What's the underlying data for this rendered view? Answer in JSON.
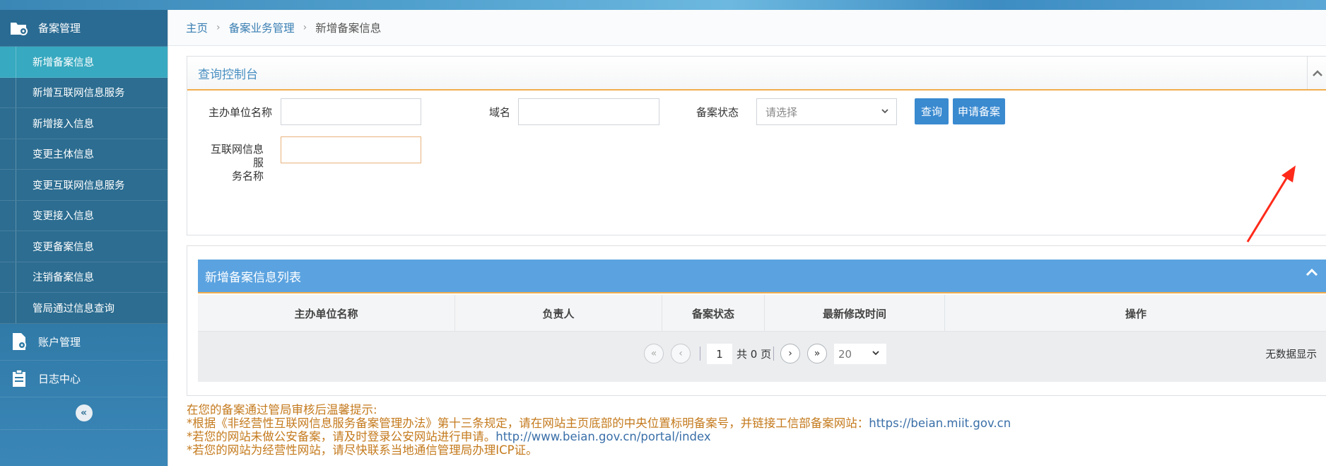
{
  "sidebar": {
    "group_filing": "备案管理",
    "items": [
      {
        "label": "新增备案信息",
        "active": true
      },
      {
        "label": "新增互联网信息服务",
        "active": false
      },
      {
        "label": "新增接入信息",
        "active": false
      },
      {
        "label": "变更主体信息",
        "active": false
      },
      {
        "label": "变更互联网信息服务",
        "active": false
      },
      {
        "label": "变更接入信息",
        "active": false
      },
      {
        "label": "变更备案信息",
        "active": false
      },
      {
        "label": "注销备案信息",
        "active": false
      },
      {
        "label": "管局通过信息查询",
        "active": false
      }
    ],
    "group_account": "账户管理",
    "group_logs": "日志中心",
    "collapse_icon": "«"
  },
  "breadcrumb": {
    "home": "主页",
    "section": "备案业务管理",
    "current": "新增备案信息",
    "separator": "›"
  },
  "query_panel": {
    "title": "查询控制台",
    "sponsor_label": "主办单位名称",
    "sponsor_value": "",
    "domain_label": "域名",
    "domain_value": "",
    "status_label": "备案状态",
    "status_placeholder": "请选择",
    "service_label_line1": "互联网信息服",
    "service_label_line2": "务名称",
    "service_value": "",
    "query_button": "查询",
    "apply_button": "申请备案"
  },
  "list_panel": {
    "title": "新增备案信息列表",
    "columns": [
      "主办单位名称",
      "负责人",
      "备案状态",
      "最新修改时间",
      "操作"
    ],
    "rows": [],
    "pager": {
      "page": "1",
      "total": "共 0 页",
      "page_size": "20",
      "empty_text": "无数据显示"
    }
  },
  "notes": {
    "line1": "在您的备案通过管局审核后温馨提示:",
    "line2_text": "*根据《非经营性互联网信息服务备案管理办法》第十三条规定，请在网站主页底部的中央位置标明备案号，并链接工信部备案网站：",
    "line2_link": "https://beian.miit.gov.cn",
    "line3_text": "*若您的网站未做公安备案，请及时登录公安网站进行申请。",
    "line3_link": "http://www.beian.gov.cn/portal/index",
    "line4_text": "*若您的网站为经营性网站，请尽快联系当地通信管理局办理ICP证。"
  },
  "colors": {
    "sidebar": "#2e7aa5",
    "active_item": "#37a9c0",
    "primary_button": "#3a8ad0",
    "list_header": "#5ba3e0",
    "accent_line": "#f0ad4e",
    "annotation_arrow": "#ff2a1a"
  }
}
